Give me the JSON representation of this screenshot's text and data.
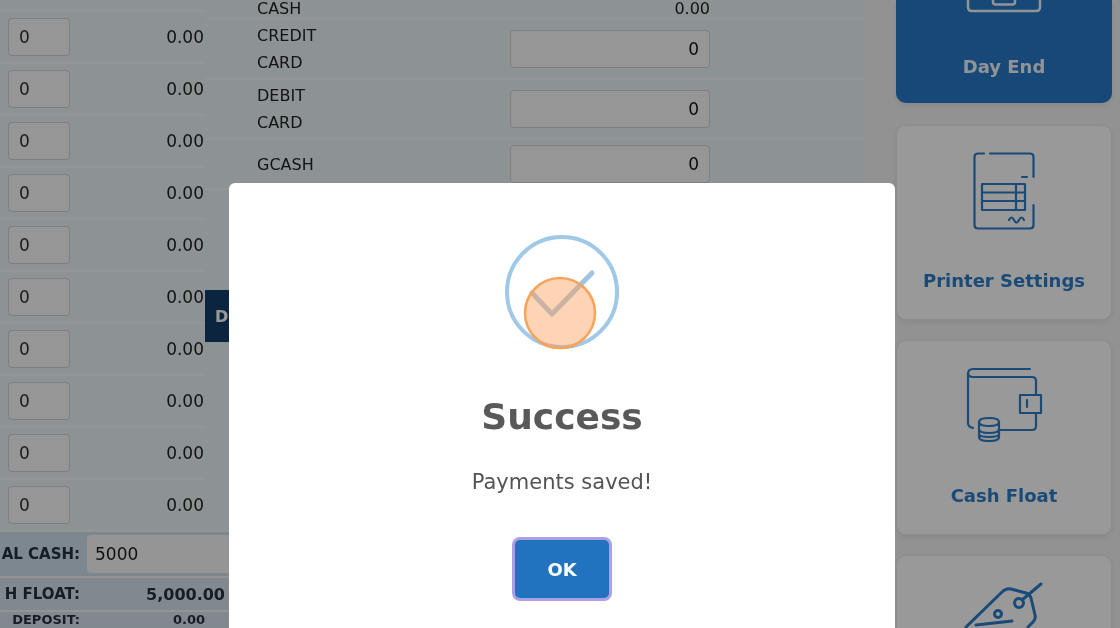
{
  "denominations": [
    {
      "count": "0",
      "amount": "0.00"
    },
    {
      "count": "0",
      "amount": "0.00"
    },
    {
      "count": "0",
      "amount": "0.00"
    },
    {
      "count": "0",
      "amount": "0.00"
    },
    {
      "count": "0",
      "amount": "0.00"
    },
    {
      "count": "0",
      "amount": "0.00"
    },
    {
      "count": "0",
      "amount": "0.00"
    },
    {
      "count": "0",
      "amount": "0.00"
    },
    {
      "count": "0",
      "amount": "0.00"
    },
    {
      "count": "0",
      "amount": "0.00"
    }
  ],
  "summary": [
    {
      "kind": "input",
      "label": "AL CASH:",
      "value": "5000"
    },
    {
      "kind": "total",
      "label": "H FLOAT:",
      "value": "5,000.00"
    },
    {
      "kind": "total",
      "label": "DEPOSIT:",
      "value": "0.00"
    }
  ],
  "payments": [
    {
      "kind": "amount",
      "label": "CASH",
      "value": "0.00"
    },
    {
      "kind": "input",
      "label": "CREDIT CARD",
      "value": "0"
    },
    {
      "kind": "input",
      "label": "DEBIT CARD",
      "value": "0"
    },
    {
      "kind": "input",
      "label": "GCASH",
      "value": "0"
    }
  ],
  "side_button": {
    "label": "D"
  },
  "tiles": [
    {
      "label": "Day End",
      "selected": true
    },
    {
      "label": "Printer Settings",
      "selected": false
    },
    {
      "label": "Cash Float",
      "selected": false
    },
    {
      "selected": false
    }
  ],
  "dialog": {
    "title": "Success",
    "message": "Payments saved!",
    "button": "OK"
  }
}
